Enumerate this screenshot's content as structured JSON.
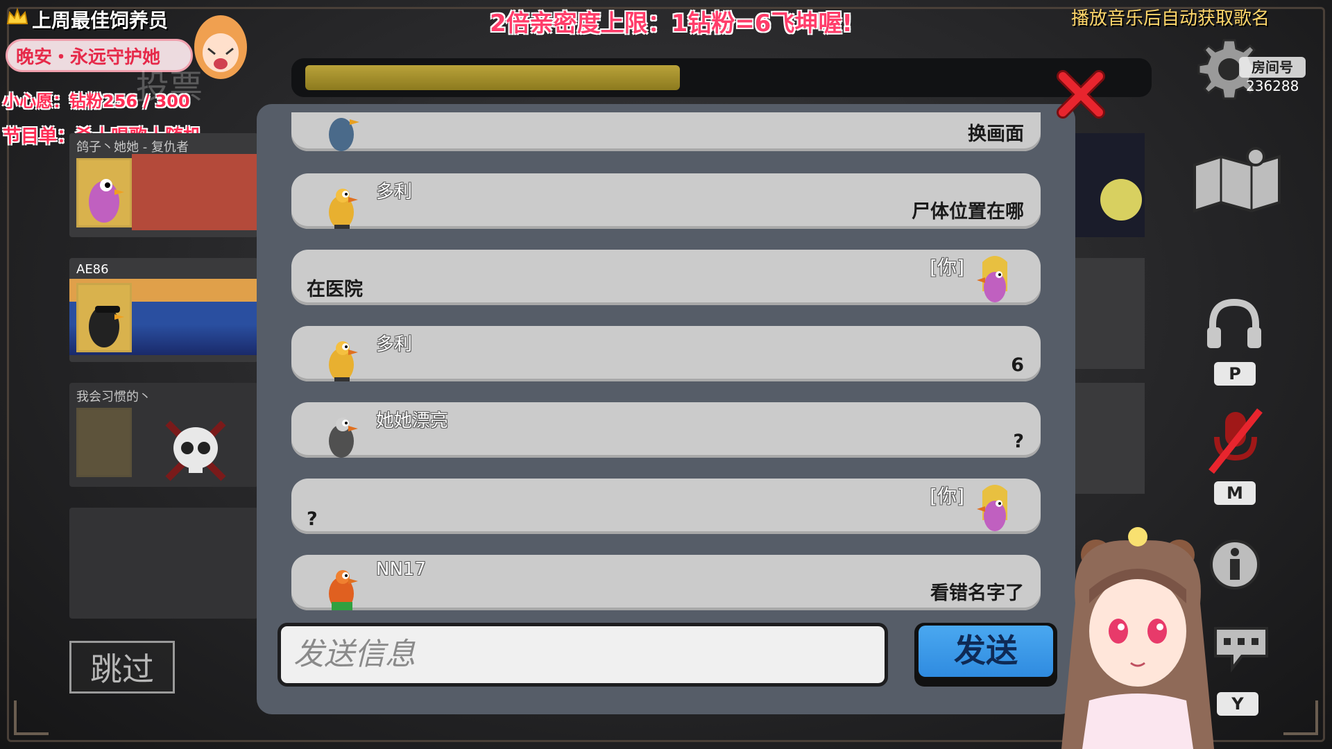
{
  "overlay": {
    "best_keeper": "上周最佳饲养员",
    "goodnight_banner": "晚安・永远守护她",
    "small_wish": "小心愿：钻粉256 / 300",
    "program_list": "节目单：杀十唱歌十随机",
    "vote_watermark": "投票",
    "center_notice": "2倍亲密度上限：1钻粉=6飞坤喔!",
    "music_notice": "播放音乐后自动获取歌名"
  },
  "room": {
    "label": "房间号",
    "number": "236288"
  },
  "progress": {
    "fraction": 0.45,
    "color": "#b9a23a"
  },
  "players": [
    {
      "name": "鸽子丶她她 - 复仇者",
      "bg": "orange"
    },
    {
      "name": "AE86",
      "bg": "earth"
    },
    {
      "name": "我会习惯的丶",
      "bg": "dead"
    }
  ],
  "skip_button": "跳过",
  "chat": {
    "messages": [
      {
        "sender": "",
        "text": "换画面",
        "side": "other",
        "duck_color": "#4a6a8a"
      },
      {
        "sender": "多利",
        "text": "尸体位置在哪",
        "side": "other",
        "duck_color": "#e8b030"
      },
      {
        "sender": "[你]",
        "text": "在医院",
        "side": "self",
        "duck_color": "#c060c0"
      },
      {
        "sender": "多利",
        "text": "6",
        "side": "other",
        "duck_color": "#e8b030"
      },
      {
        "sender": "她她漂亮",
        "text": "?",
        "side": "other",
        "duck_color": "#505050"
      },
      {
        "sender": "[你]",
        "text": "?",
        "side": "self",
        "duck_color": "#c060c0"
      },
      {
        "sender": "NN17",
        "text": "看错名字了",
        "side": "other",
        "duck_color": "#e06020"
      }
    ],
    "input_placeholder": "发送信息",
    "send_label": "发送"
  },
  "keys": {
    "push_to_talk": "P",
    "mute": "M",
    "chat_key": "Y"
  },
  "icons": [
    "crown-icon",
    "settings-gear-icon",
    "map-icon",
    "headphones-icon",
    "mic-muted-icon",
    "info-icon",
    "chat-icon",
    "close-icon"
  ],
  "colors": {
    "accent_red": "#ff2d55",
    "send_blue": "#3a9ae8",
    "panel": "#565d68",
    "bubble": "#cbcbcb"
  }
}
